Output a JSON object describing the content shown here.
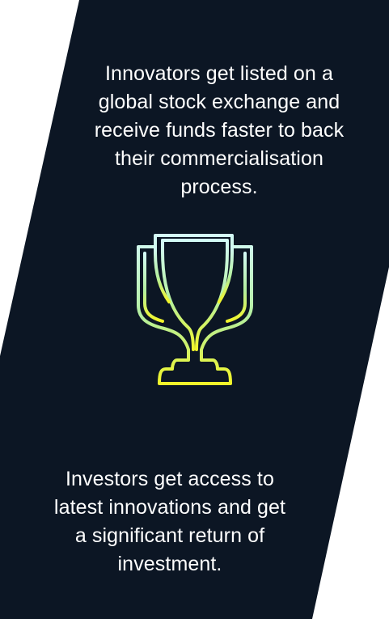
{
  "panel": {
    "background": "#0c1624",
    "page_background": "#ffffff"
  },
  "top_text": "Innovators get listed on a\nglobal stock exchange and\nreceive funds faster to back\ntheir commercialisation\nprocess.",
  "bottom_text": "Investors get access to\nlatest innovations and get\na significant return of\ninvestment.",
  "icon": {
    "name": "trophy-icon",
    "gradient_top": "#d4fbf7",
    "gradient_bottom": "#f2f52a"
  }
}
